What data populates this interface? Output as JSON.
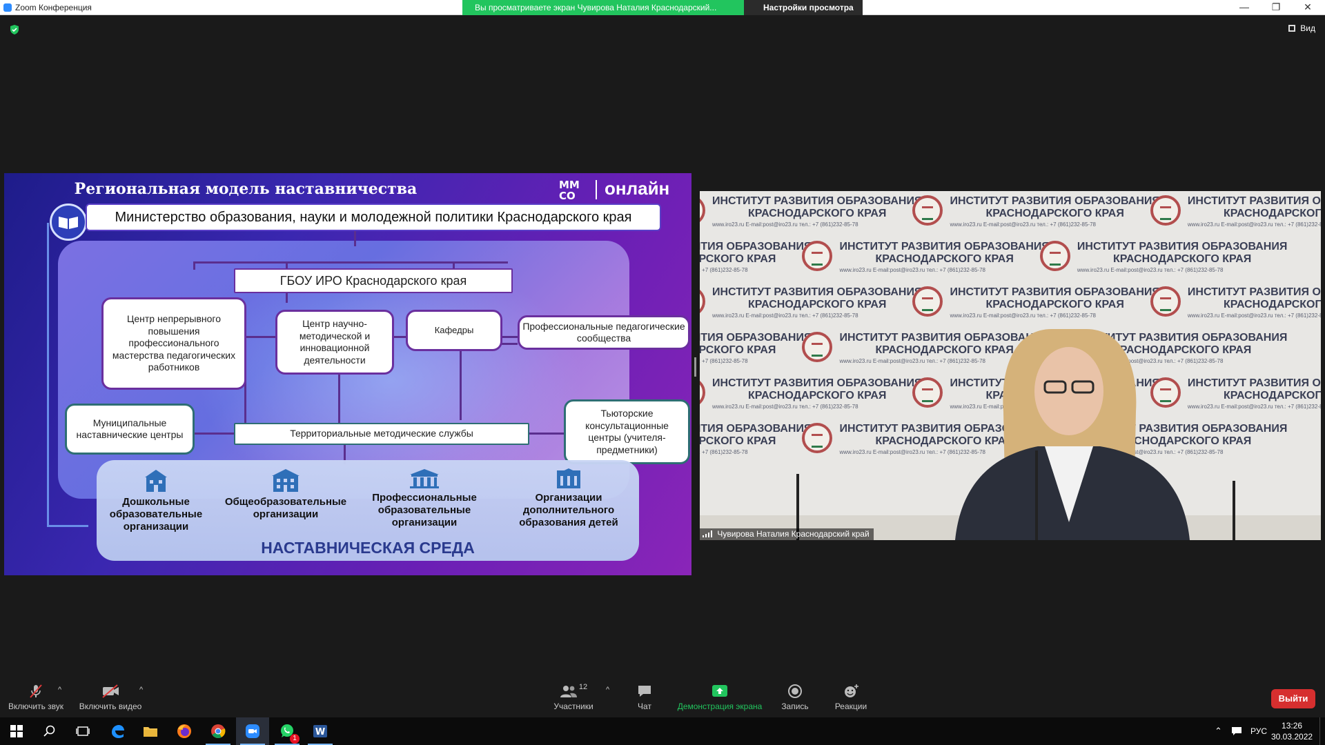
{
  "window": {
    "title": "Zoom Конференция",
    "share_banner": "Вы просматриваете экран Чувирова Наталия Краснодарский...",
    "view_options": "Настройки просмотра",
    "minimize": "—",
    "maximize": "❐",
    "close": "✕"
  },
  "meeting": {
    "view_label": "Вид"
  },
  "slide": {
    "title": "Региональная  модель наставничества",
    "logo_text": "онлайн",
    "ministry": "Министерство образования, науки и молодежной политики Краснодарского края",
    "gbou": "ГБОУ ИРО Краснодарского края",
    "center_continuous": "Центр непрерывного повышения профессионального мастерства педагогических работников",
    "center_scientific": "Центр научно-методической и инновационной деятельности",
    "departments": "Кафедры",
    "prof_communities": "Профессиональные педагогические сообщества",
    "municipal_centers": "Муниципальные наставнические центры",
    "territorial_services": "Территориальные методические службы",
    "tutor_centers": "Тьюторские консультационные центры (учителя-предметники)",
    "orgs": [
      {
        "label": "Дошкольные образовательные организации"
      },
      {
        "label": "Общеобразовательные организации"
      },
      {
        "label": "Профессиональные образовательные организации"
      },
      {
        "label": "Организации дополнительного образования детей"
      }
    ],
    "environment": "НАСТАВНИЧЕСКАЯ СРЕДА"
  },
  "video": {
    "wall_text_line1": "ИНСТИТУТ РАЗВИТИЯ ОБРАЗОВАНИЯ",
    "wall_text_line2": "КРАСНОДАРСКОГО КРАЯ",
    "wall_small": "www.iro23.ru   E-mail:post@iro23.ru   тел.: +7 (861)232-85-78",
    "participant_name": "Чувирова Наталия Краснодарский край"
  },
  "toolbar": {
    "unmute": "Включить звук",
    "start_video": "Включить видео",
    "participants": "Участники",
    "participants_count": "12",
    "chat": "Чат",
    "share_screen": "Демонстрация экрана",
    "record": "Запись",
    "reactions": "Реакции",
    "leave": "Выйти",
    "caret": "^"
  },
  "taskbar": {
    "language": "РУС",
    "time": "13:26",
    "date": "30.03.2022",
    "whatsapp_badge": "1"
  },
  "colors": {
    "zoom_blue": "#2d8cff",
    "share_green": "#22c55e",
    "leave_red": "#d62f2f"
  }
}
